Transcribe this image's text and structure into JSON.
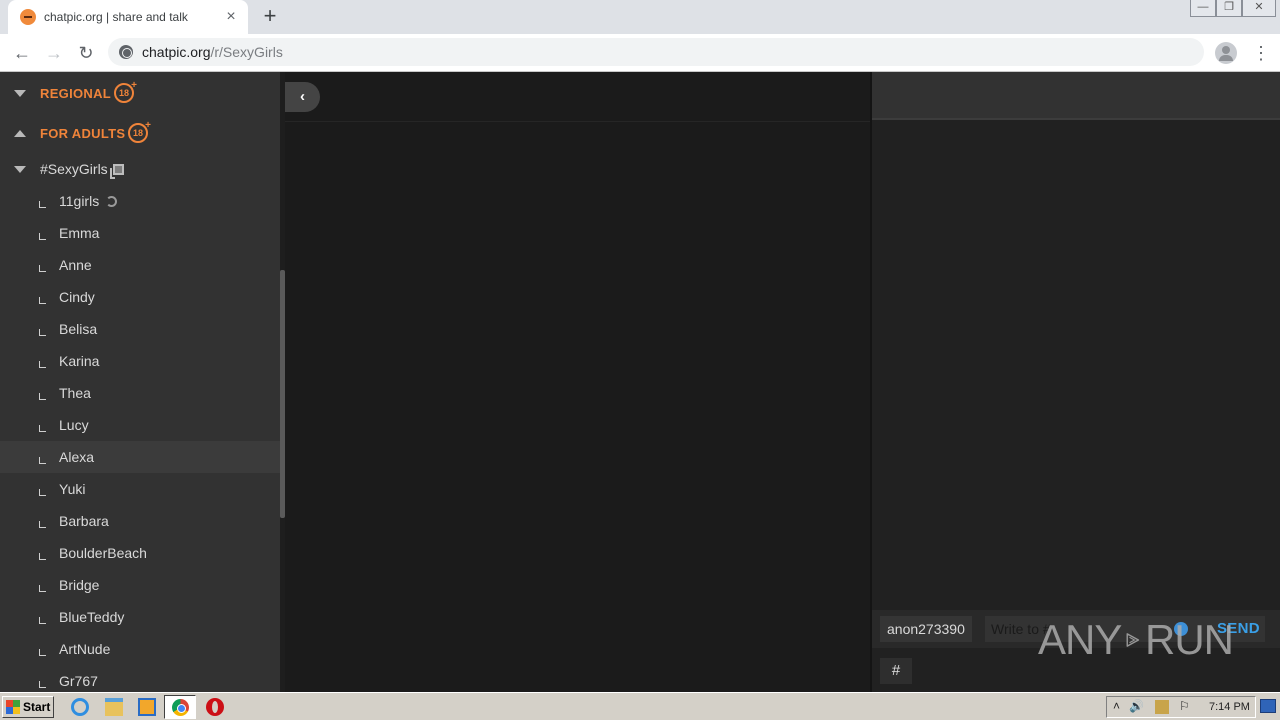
{
  "browser": {
    "tab_title": "chatpic.org | share and talk",
    "tab_close_icon": "×",
    "new_tab_icon": "+",
    "url_host": "chatpic.org",
    "url_path": "/r/SexyGirls",
    "back_icon": "←",
    "forward_icon": "→",
    "reload_icon": "↻",
    "menu_icon": "⋮",
    "window_minimize": "—",
    "window_restore": "❐",
    "window_close": "✕"
  },
  "sidebar": {
    "categories": [
      {
        "label": "REGIONAL",
        "badge": "18",
        "expanded": false
      },
      {
        "label": "FOR ADULTS",
        "badge": "18",
        "expanded": true
      }
    ],
    "channel": {
      "label": "#SexyGirls",
      "expanded": true
    },
    "subchannels": [
      {
        "label": "11girls",
        "loading": true
      },
      {
        "label": "Emma"
      },
      {
        "label": "Anne"
      },
      {
        "label": "Cindy"
      },
      {
        "label": "Belisa"
      },
      {
        "label": "Karina"
      },
      {
        "label": "Thea"
      },
      {
        "label": "Lucy"
      },
      {
        "label": "Alexa",
        "highlighted": true
      },
      {
        "label": "Yuki"
      },
      {
        "label": "Barbara"
      },
      {
        "label": "BoulderBeach"
      },
      {
        "label": "Bridge"
      },
      {
        "label": "BlueTeddy"
      },
      {
        "label": "ArtNude"
      },
      {
        "label": "Gr767"
      }
    ]
  },
  "main": {
    "collapse_icon": "‹"
  },
  "chat": {
    "username": "anon273390",
    "input_placeholder": "Write to #",
    "send_label": "SEND",
    "hash_label": "#"
  },
  "watermark": {
    "left": "ANY",
    "right": "RUN"
  },
  "taskbar": {
    "start_label": "Start",
    "clock": "7:14 PM",
    "tray_expand_icon": "˄",
    "volume_icon": "🔊",
    "flag_icon": "⚐"
  },
  "colors": {
    "accent_orange": "#f0843a",
    "send_blue": "#3aa0e8",
    "sidebar_bg": "#323232",
    "main_bg": "#1b1b1b"
  }
}
